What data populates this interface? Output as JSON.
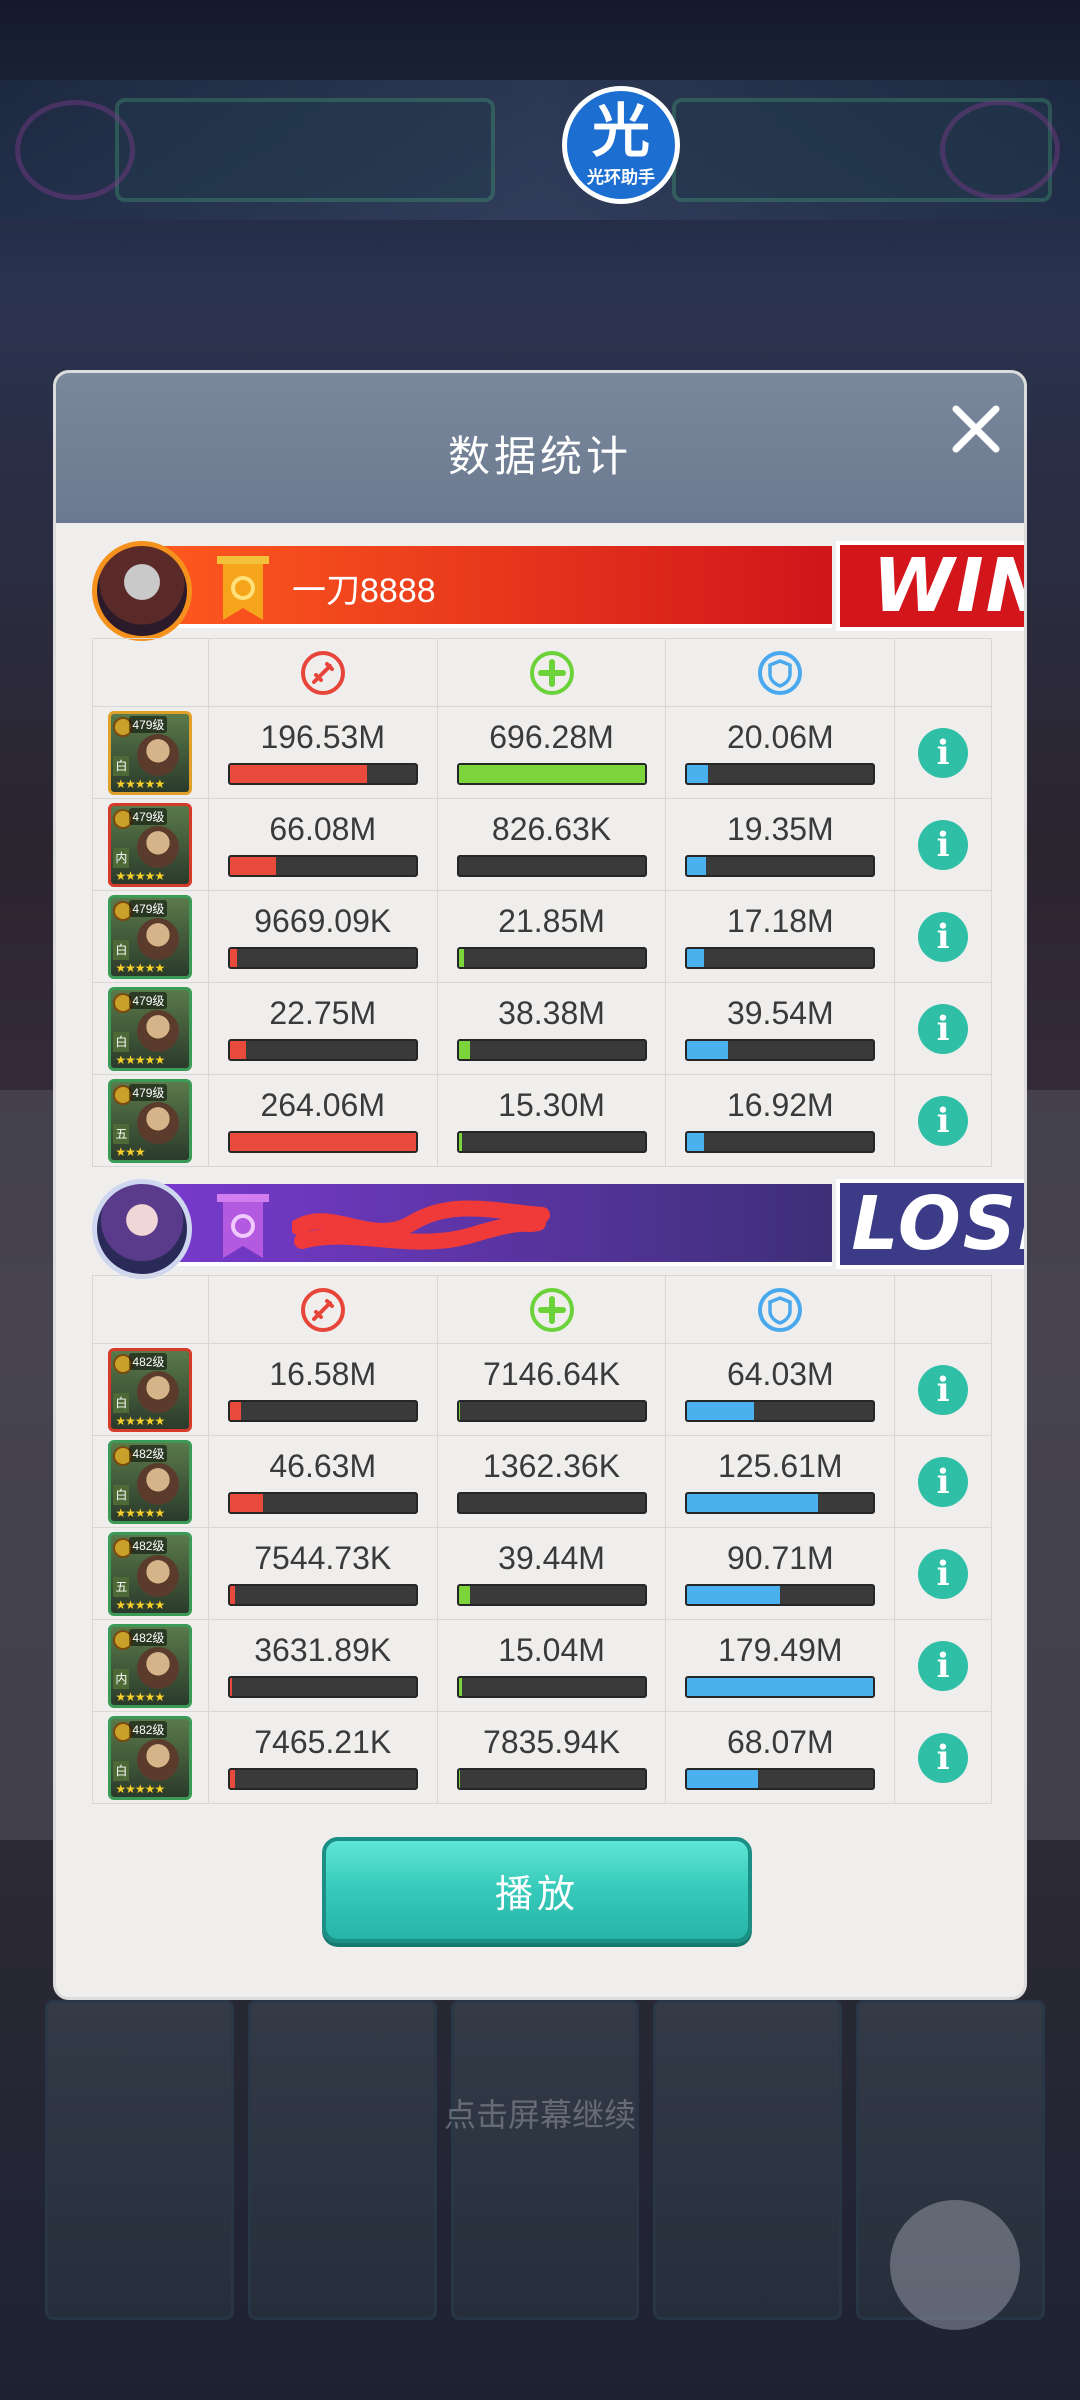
{
  "logo": {
    "glyph": "光",
    "text": "光环助手"
  },
  "background": {
    "hint": "点击屏幕继续"
  },
  "dialog": {
    "title": "数据统计",
    "close_icon": "close-icon"
  },
  "stat_icons": [
    "damage-icon",
    "heal-icon",
    "shield-icon"
  ],
  "colors": {
    "damage": "#e84a3c",
    "heal": "#7bd43a",
    "shield": "#4ab0ee",
    "win": "#d3151c",
    "lose": "#3b3b88",
    "info": "#2fbfa7"
  },
  "teams": [
    {
      "name": "一刀8888",
      "result": "WIN",
      "rows": [
        {
          "level": "479级",
          "role": "白",
          "stars": "★★★★★",
          "damage": "196.53M",
          "heal": "696.28M",
          "shield": "20.06M",
          "damage_fill": 0.74,
          "heal_fill": 1.0,
          "shield_fill": 0.11
        },
        {
          "level": "479级",
          "role": "内",
          "stars": "★★★★★",
          "damage": "66.08M",
          "heal": "826.63K",
          "shield": "19.35M",
          "damage_fill": 0.25,
          "heal_fill": 0.0,
          "shield_fill": 0.1
        },
        {
          "level": "479级",
          "role": "白",
          "stars": "★★★★★",
          "damage": "9669.09K",
          "heal": "21.85M",
          "shield": "17.18M",
          "damage_fill": 0.04,
          "heal_fill": 0.03,
          "shield_fill": 0.09
        },
        {
          "level": "479级",
          "role": "白",
          "stars": "★★★★★",
          "damage": "22.75M",
          "heal": "38.38M",
          "shield": "39.54M",
          "damage_fill": 0.09,
          "heal_fill": 0.06,
          "shield_fill": 0.22
        },
        {
          "level": "479级",
          "role": "五",
          "stars": "★★★",
          "damage": "264.06M",
          "heal": "15.30M",
          "shield": "16.92M",
          "damage_fill": 1.0,
          "heal_fill": 0.02,
          "shield_fill": 0.09
        }
      ]
    },
    {
      "name": "",
      "result": "LOSE",
      "rows": [
        {
          "level": "482级",
          "role": "白",
          "stars": "★★★★★",
          "damage": "16.58M",
          "heal": "7146.64K",
          "shield": "64.03M",
          "damage_fill": 0.06,
          "heal_fill": 0.01,
          "shield_fill": 0.36
        },
        {
          "level": "482级",
          "role": "白",
          "stars": "★★★★★",
          "damage": "46.63M",
          "heal": "1362.36K",
          "shield": "125.61M",
          "damage_fill": 0.18,
          "heal_fill": 0.0,
          "shield_fill": 0.7
        },
        {
          "level": "482级",
          "role": "五",
          "stars": "★★★★★",
          "damage": "7544.73K",
          "heal": "39.44M",
          "shield": "90.71M",
          "damage_fill": 0.03,
          "heal_fill": 0.06,
          "shield_fill": 0.5
        },
        {
          "level": "482级",
          "role": "内",
          "stars": "★★★★★",
          "damage": "3631.89K",
          "heal": "15.04M",
          "shield": "179.49M",
          "damage_fill": 0.01,
          "heal_fill": 0.02,
          "shield_fill": 1.0
        },
        {
          "level": "482级",
          "role": "白",
          "stars": "★★★★★",
          "damage": "7465.21K",
          "heal": "7835.94K",
          "shield": "68.07M",
          "damage_fill": 0.03,
          "heal_fill": 0.01,
          "shield_fill": 0.38
        }
      ]
    }
  ],
  "play_button": {
    "label": "播放"
  }
}
